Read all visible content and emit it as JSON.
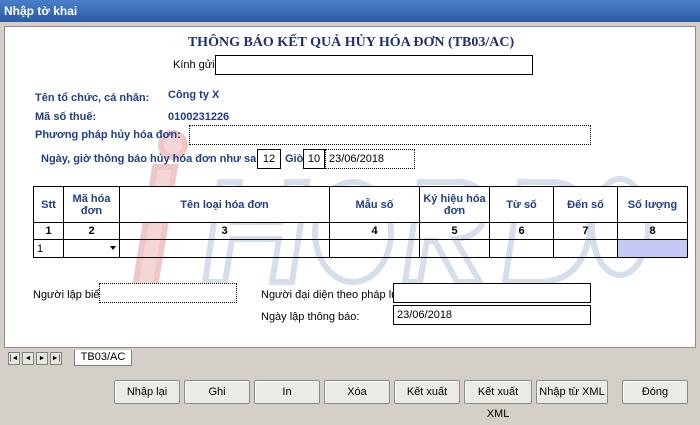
{
  "window": {
    "title": "Nhập tờ khai"
  },
  "form": {
    "heading": "THÔNG BÁO KẾT QUẢ HỦY HÓA ĐƠN (TB03/AC)",
    "kinh_gui_label": "Kính gửi:",
    "kinh_gui_value": "",
    "org_label": "Tên tổ chức, cá nhân:",
    "org_value": "Công ty X",
    "tax_label": "Mã số thuế:",
    "tax_value": "0100231226",
    "method_label": "Phương pháp hủy hóa đơn:",
    "method_value": "",
    "date_label": "Ngày, giờ thông báo hủy hóa đơn như sau:",
    "hour_value": "12",
    "gio_label": "Giờ",
    "minute_value": "10",
    "date_value": "23/06/2018"
  },
  "table": {
    "headers": [
      "Stt",
      "Mã hóa đơn",
      "Tên loại hóa đơn",
      "Mẫu số",
      "Ký hiệu hóa đơn",
      "Từ số",
      "Đến số",
      "Số lượng"
    ],
    "numbers": [
      "1",
      "2",
      "3",
      "4",
      "5",
      "6",
      "7",
      "8"
    ],
    "rows": [
      {
        "stt": "1",
        "ma": "",
        "ten": "",
        "mau": "",
        "ky_hieu": "",
        "tu": "",
        "den": "",
        "so_luong": ""
      }
    ],
    "highlight_color": "#c8c8f4"
  },
  "footer": {
    "nguoi_lap_label": "Người lập biểu:",
    "nguoi_lap_value": "",
    "dai_dien_label": "Người đại diện theo pháp luật",
    "dai_dien_value": "",
    "ngay_lap_label": "Ngày lập thông báo:",
    "ngay_lap_value": "23/06/2018"
  },
  "tabs": {
    "sheet_tab": "TB03/AC",
    "nav": [
      "|◄",
      "◄",
      "►",
      "►|"
    ]
  },
  "buttons": {
    "nhap_lai": "Nhập lại",
    "ghi": "Ghi",
    "in": "In",
    "xoa": "Xóa",
    "ket_xuat": "Kết xuất",
    "ket_xuat_xml": "Kết xuất XML",
    "nhap_tu_xml": "Nhập từ XML",
    "dong": "Đóng"
  },
  "colors": {
    "titlebar": "#2c5aa8",
    "label_blue": "#1f3d8a",
    "background": "#d4d0c8"
  }
}
